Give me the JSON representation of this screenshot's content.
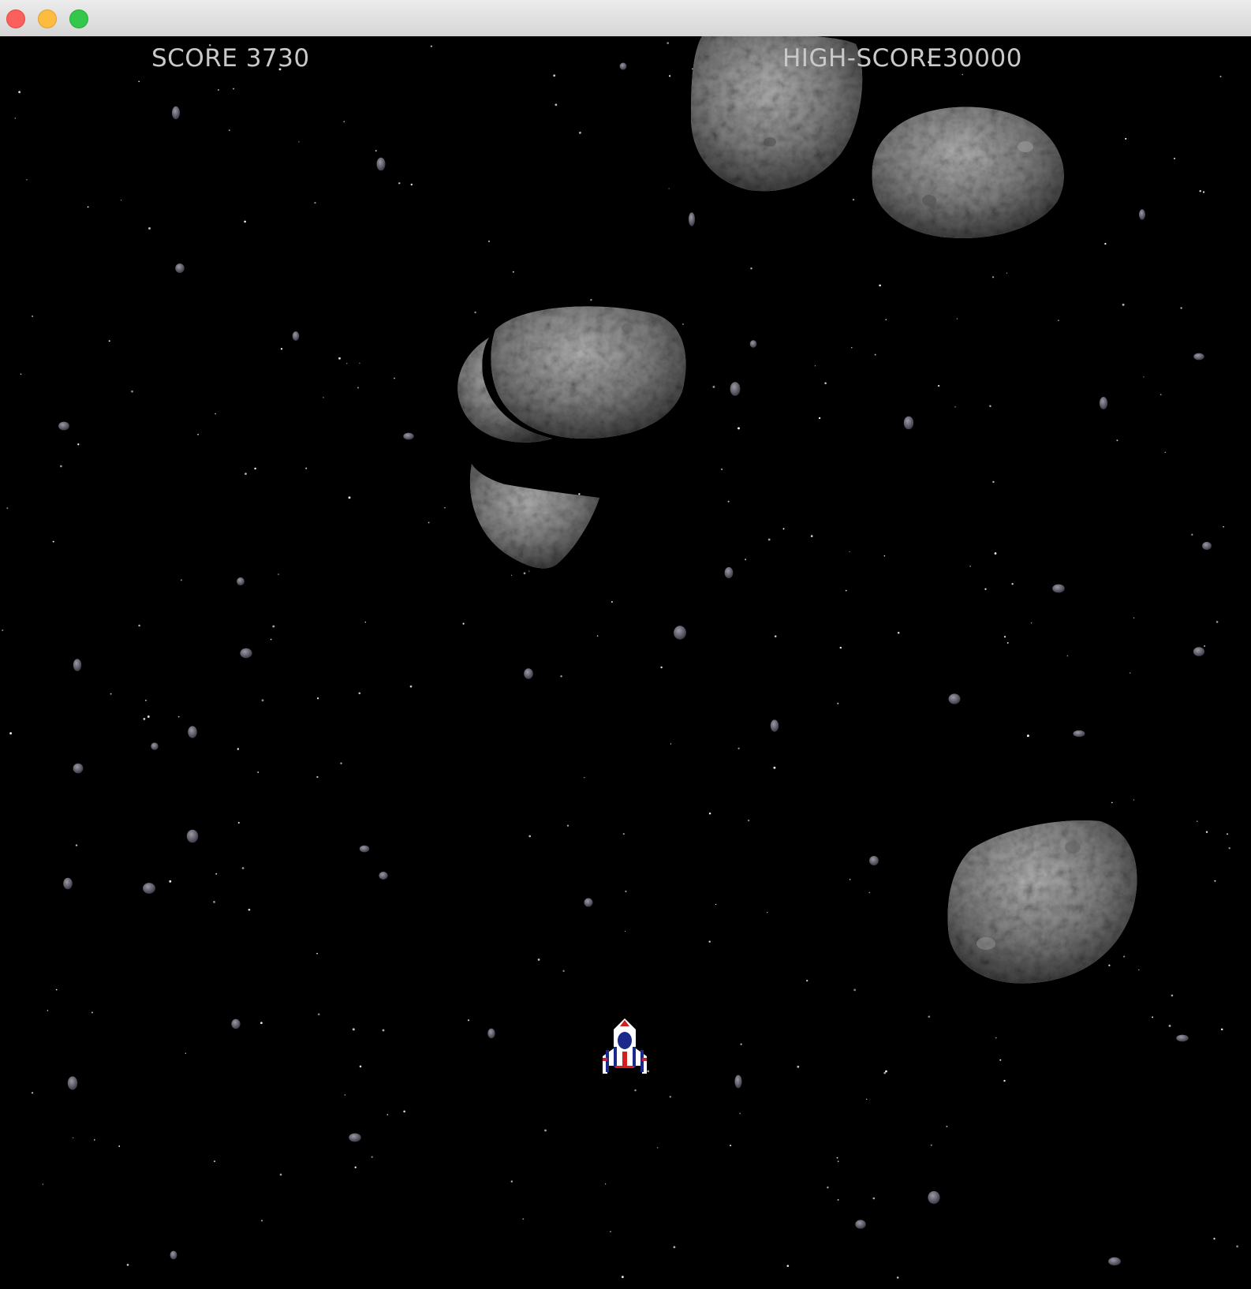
{
  "window": {
    "buttons": {
      "close_icon": "close-icon",
      "minimize_icon": "minimize-icon",
      "zoom_icon": "zoom-icon"
    }
  },
  "hud": {
    "score_text": "SCORE 3730",
    "highscore_text": "HIGH-SCORE30000"
  },
  "colors": {
    "space": "#000000",
    "asteroid": "#7a7a7a",
    "hud_text": "#c9c9c9",
    "ship_red": "#d21f1f",
    "ship_blue": "#1b2a8a"
  }
}
